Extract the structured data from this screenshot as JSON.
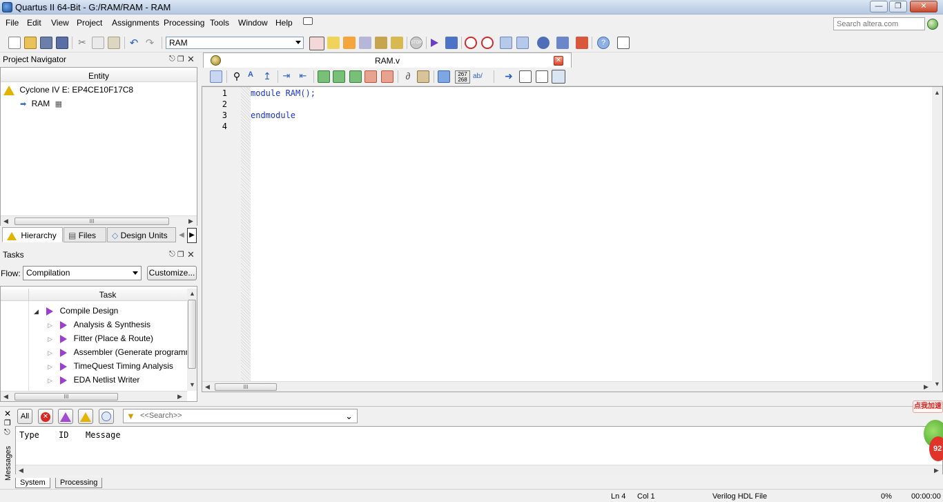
{
  "window": {
    "title": "Quartus II 64-Bit - G:/RAM/RAM - RAM"
  },
  "menu": [
    "File",
    "Edit",
    "View",
    "Project",
    "Assignments",
    "Processing",
    "Tools",
    "Window",
    "Help"
  ],
  "search": {
    "placeholder": "Search altera.com"
  },
  "toolbar": {
    "entity_selector": "RAM"
  },
  "project_navigator": {
    "title": "Project Navigator",
    "column": "Entity",
    "device": "Cyclone IV E: EP4CE10F17C8",
    "top_entity": "RAM",
    "tabs": [
      "Hierarchy",
      "Files",
      "Design Units"
    ]
  },
  "tasks": {
    "title": "Tasks",
    "flow_label": "Flow:",
    "flow_value": "Compilation",
    "customize_label": "Customize...",
    "column": "Task",
    "items": [
      {
        "label": "Compile Design",
        "level": 0
      },
      {
        "label": "Analysis & Synthesis",
        "level": 1
      },
      {
        "label": "Fitter (Place & Route)",
        "level": 1
      },
      {
        "label": "Assembler (Generate programming",
        "level": 1
      },
      {
        "label": "TimeQuest Timing Analysis",
        "level": 1
      },
      {
        "label": "EDA Netlist Writer",
        "level": 1
      }
    ]
  },
  "editor": {
    "tab_name": "RAM.v",
    "lines": [
      {
        "num": "1",
        "text": "module RAM();"
      },
      {
        "num": "2",
        "text": ""
      },
      {
        "num": "3",
        "text": "endmodule"
      },
      {
        "num": "4",
        "text": ""
      }
    ],
    "line_count_badge_top": "267",
    "line_count_badge_bottom": "268",
    "spell_label": "ab/"
  },
  "messages": {
    "all_label": "All",
    "search_placeholder": "<<Search>>",
    "columns": [
      "Type",
      "ID",
      "Message"
    ],
    "side_label": "Messages",
    "tabs": [
      "System",
      "Processing"
    ]
  },
  "status": {
    "ln": "Ln 4",
    "col": "Col 1",
    "file_type": "Verilog HDL File",
    "progress": "0%",
    "time": "00:00:00"
  },
  "ad": {
    "text": "点我加速",
    "value": "92"
  },
  "colors": {
    "keyword": "#1a35c9",
    "task_arrow": "#9a3fd0",
    "warning": "#e2b300"
  }
}
